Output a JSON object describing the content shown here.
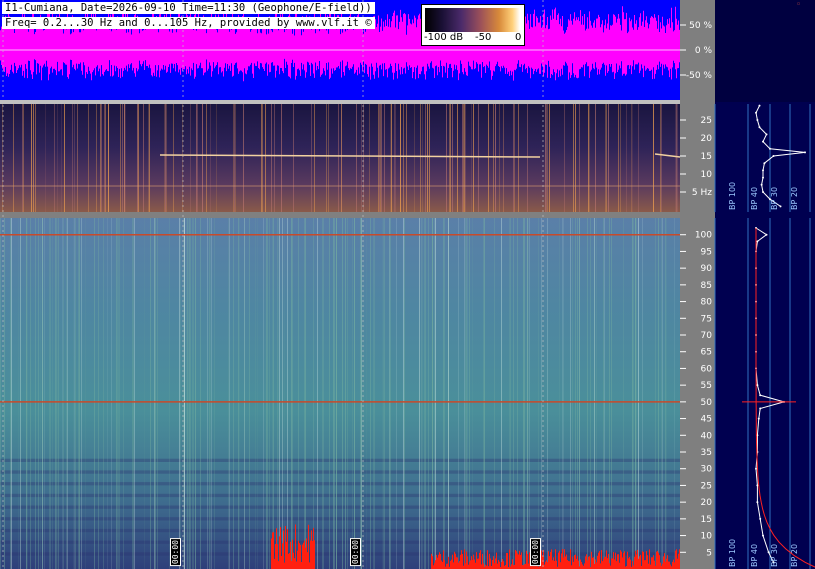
{
  "header": {
    "line1": "I1-Cumiana, Date=2026-09-10 Time=11:30 (Geophone/E-field))",
    "line2": "Freq= 0.2...30 Hz and 0...105 Hz, provided by www.vlf.it ©"
  },
  "colorbar": {
    "label_min": "-100 dB",
    "label_mid": "-50",
    "label_max": "0"
  },
  "time_markers": [
    "00:00",
    "00:00",
    "00:00"
  ],
  "side_labels": {
    "bp_top": [
      "BP 100",
      "BP 40",
      "BP 30",
      "BP 20"
    ],
    "bp_bottom": [
      "BP 100",
      "BP 40",
      "BP 30",
      "BP 20"
    ]
  },
  "colors": {
    "waveform_bg": "#0000ff",
    "waveform": "#ff00ff",
    "scale_panel": "#7f7f7f",
    "right_panel": "#000050",
    "spectrum_curve": "#ffffff",
    "reference_line": "#ff2020"
  },
  "chart_data": [
    {
      "type": "line",
      "name": "amplitude waveform",
      "yunit": "%",
      "yticks": [
        50,
        0,
        -50
      ],
      "ytick_labels": [
        "50 %",
        "0 %",
        "-50 %"
      ],
      "ylim": [
        -100,
        100
      ]
    },
    {
      "type": "heatmap",
      "name": "low-frequency spectrogram",
      "yunit": "Hz",
      "ylim": [
        0,
        30
      ],
      "yticks": [
        5,
        10,
        15,
        20,
        25
      ],
      "ytick_labels": [
        "5 Hz",
        "10",
        "15",
        "20",
        "25"
      ],
      "notable_lines_hz": [
        16,
        15
      ]
    },
    {
      "type": "heatmap",
      "name": "high-frequency spectrogram",
      "ylim": [
        0,
        105
      ],
      "yticks": [
        5,
        10,
        15,
        20,
        25,
        30,
        35,
        40,
        45,
        50,
        55,
        60,
        65,
        70,
        75,
        80,
        85,
        90,
        95,
        100
      ],
      "notable_lines_hz": [
        50,
        100
      ]
    },
    {
      "type": "line",
      "name": "low-frequency average spectrum",
      "freq_hz": [
        1,
        3,
        5,
        7,
        9,
        11,
        13,
        15,
        16,
        17,
        19,
        21,
        23,
        25,
        27,
        29
      ],
      "level": [
        0.55,
        0.4,
        0.3,
        0.28,
        0.3,
        0.3,
        0.32,
        0.45,
        0.9,
        0.4,
        0.3,
        0.35,
        0.25,
        0.22,
        0.2,
        0.25
      ]
    },
    {
      "type": "line",
      "name": "high-frequency average spectrum",
      "freq_hz": [
        2,
        5,
        10,
        15,
        20,
        25,
        30,
        35,
        40,
        45,
        48,
        50,
        52,
        55,
        60,
        65,
        70,
        75,
        80,
        85,
        90,
        95,
        98,
        100,
        102
      ],
      "level": [
        0.45,
        0.38,
        0.3,
        0.26,
        0.22,
        0.22,
        0.2,
        0.22,
        0.22,
        0.24,
        0.26,
        0.6,
        0.26,
        0.22,
        0.2,
        0.2,
        0.2,
        0.2,
        0.2,
        0.2,
        0.2,
        0.2,
        0.22,
        0.35,
        0.2
      ]
    }
  ]
}
